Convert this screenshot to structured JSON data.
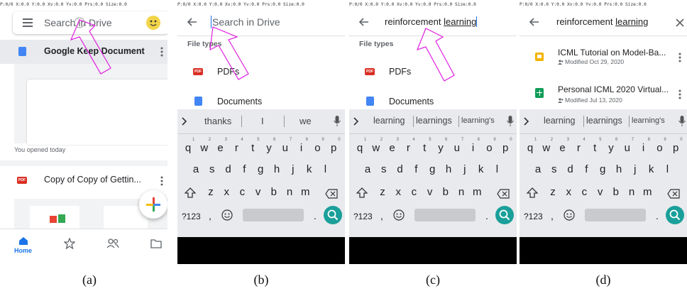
{
  "debug_bar": "P:0/0   X:0.0   Y:0.0   Xv:0.0   Yv:0.0   Prs:0.0  Size:0.0",
  "captions": [
    "(a)",
    "(b)",
    "(c)",
    "(d)"
  ],
  "panel_a": {
    "search_placeholder": "Search in Drive",
    "doc_title": "Google Keep Document",
    "opened_label": "You opened today",
    "copy_title": "Copy of Copy of Gettin...",
    "pdf_badge": "PDF",
    "nav_home": "Home"
  },
  "panel_b": {
    "search_placeholder": "Search in Drive",
    "file_types_label": "File types",
    "pdfs_label": "PDFs",
    "documents_label": "Documents",
    "pdf_badge": "PDF",
    "suggestions": [
      "thanks",
      "I",
      "we"
    ]
  },
  "panel_c": {
    "query_plain": "reinforcement ",
    "query_underlined": "learning",
    "file_types_label": "File types",
    "pdfs_label": "PDFs",
    "documents_label": "Documents",
    "pdf_badge": "PDF",
    "suggestions": [
      "learning",
      "learnings",
      "learning's"
    ]
  },
  "panel_d": {
    "query_plain": "reinforcement ",
    "query_underlined": "learning",
    "results": [
      {
        "title": "ICML Tutorial on Model-Ba...",
        "modified": "Modified Oct 29, 2020"
      },
      {
        "title": "Personal ICML 2020 Virtual...",
        "modified": "Modified Jul 13, 2020"
      }
    ],
    "suggestions": [
      "learning",
      "learnings",
      "learning's"
    ]
  },
  "keyboard": {
    "row1": [
      "q",
      "w",
      "e",
      "r",
      "t",
      "y",
      "u",
      "i",
      "o",
      "p"
    ],
    "row1_digits": [
      "1",
      "2",
      "3",
      "4",
      "5",
      "6",
      "7",
      "8",
      "9",
      "0"
    ],
    "row2": [
      "a",
      "s",
      "d",
      "f",
      "g",
      "h",
      "j",
      "k",
      "l"
    ],
    "row3": [
      "z",
      "x",
      "c",
      "v",
      "b",
      "n",
      "m"
    ],
    "symbols_key": "?123",
    "comma": ",",
    "period": "."
  },
  "colors": {
    "accent_teal": "#1a9f9a",
    "cursor_magenta": "#e020e0",
    "doc_blue": "#4285f4",
    "pdf_red": "#d93025",
    "slides_yellow": "#f4b400",
    "sheets_green": "#0f9d58"
  }
}
